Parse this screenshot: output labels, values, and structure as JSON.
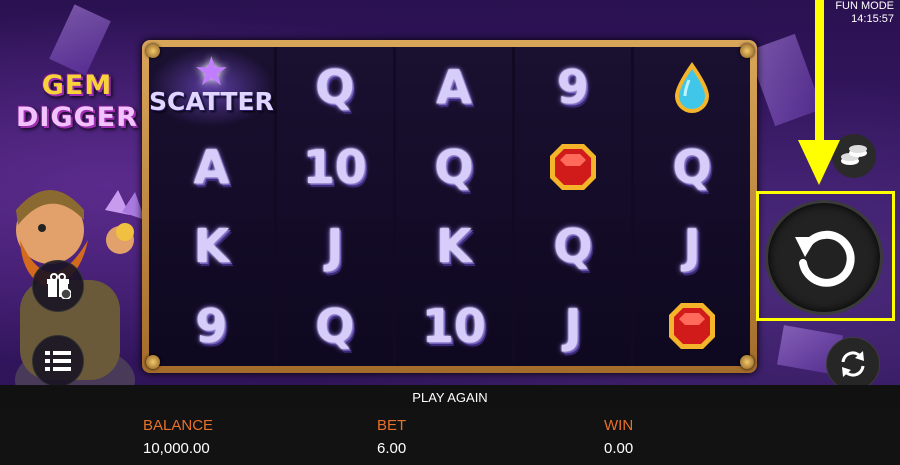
{
  "header": {
    "mode": "FUN MODE",
    "time": "14:15:57"
  },
  "logo": {
    "line1": "GEM",
    "line2": "DIGGER"
  },
  "reels": [
    [
      "scatter",
      "A",
      "K",
      "9"
    ],
    [
      "Q",
      "10",
      "J",
      "Q"
    ],
    [
      "A",
      "Q",
      "K",
      "10"
    ],
    [
      "9",
      "red-gem",
      "Q",
      "J"
    ],
    [
      "blue-gem",
      "Q",
      "J",
      "red-gem"
    ]
  ],
  "scatter_label": "SCATTER",
  "message": "PLAY AGAIN",
  "bottom": {
    "balance_label": "BALANCE",
    "balance": "10,000.00",
    "bet_label": "BET",
    "bet": "6.00",
    "win_label": "WIN",
    "win": "0.00"
  },
  "colors": {
    "highlight": "#ffff00",
    "label": "#e8702a",
    "frame": "#c18a40"
  }
}
